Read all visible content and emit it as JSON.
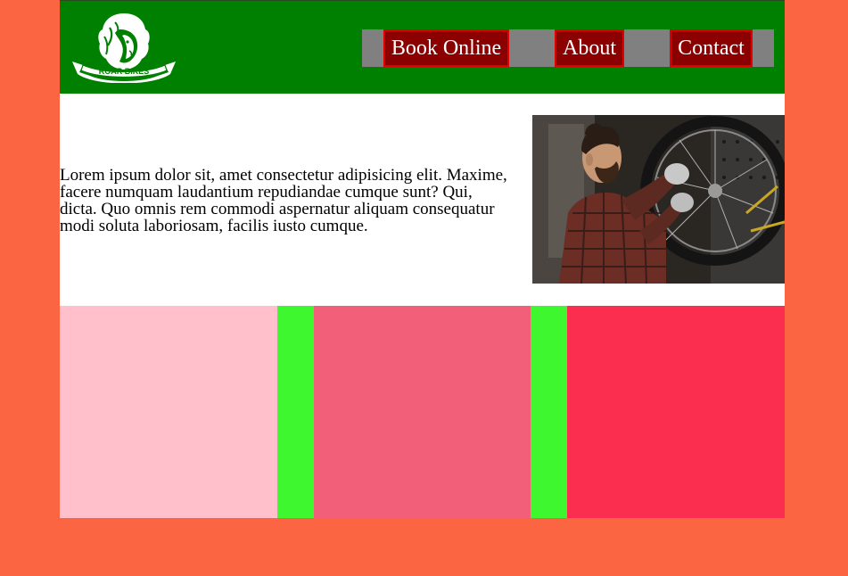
{
  "logo": {
    "icon": "lion-head-icon",
    "brand_text": "ROAR BIKES"
  },
  "nav": {
    "items": [
      {
        "label": "Book Online"
      },
      {
        "label": "About"
      },
      {
        "label": "Contact"
      }
    ]
  },
  "intro": {
    "text": "Lorem ipsum dolor sit, amet consectetur adipisicing elit. Maxime, facere numquam laudantium repudiandae cumque sunt? Qui, dicta. Quo omnis rem commodi aspernatur aliquam consequatur modi soluta laboriosam, facilis iusto cumque."
  },
  "photo": {
    "subject": "bike-mechanic-photo"
  },
  "colors": {
    "page_background": "#fb6541",
    "header_background": "#008000",
    "nav_background": "#808080",
    "nav_button_background": "#8b0000",
    "nav_button_border": "#e00000",
    "tile_1": "#ffc0cb",
    "tile_2": "#f15f79",
    "tile_3": "#fc2e50",
    "tile_gap": "#3ef72e"
  }
}
